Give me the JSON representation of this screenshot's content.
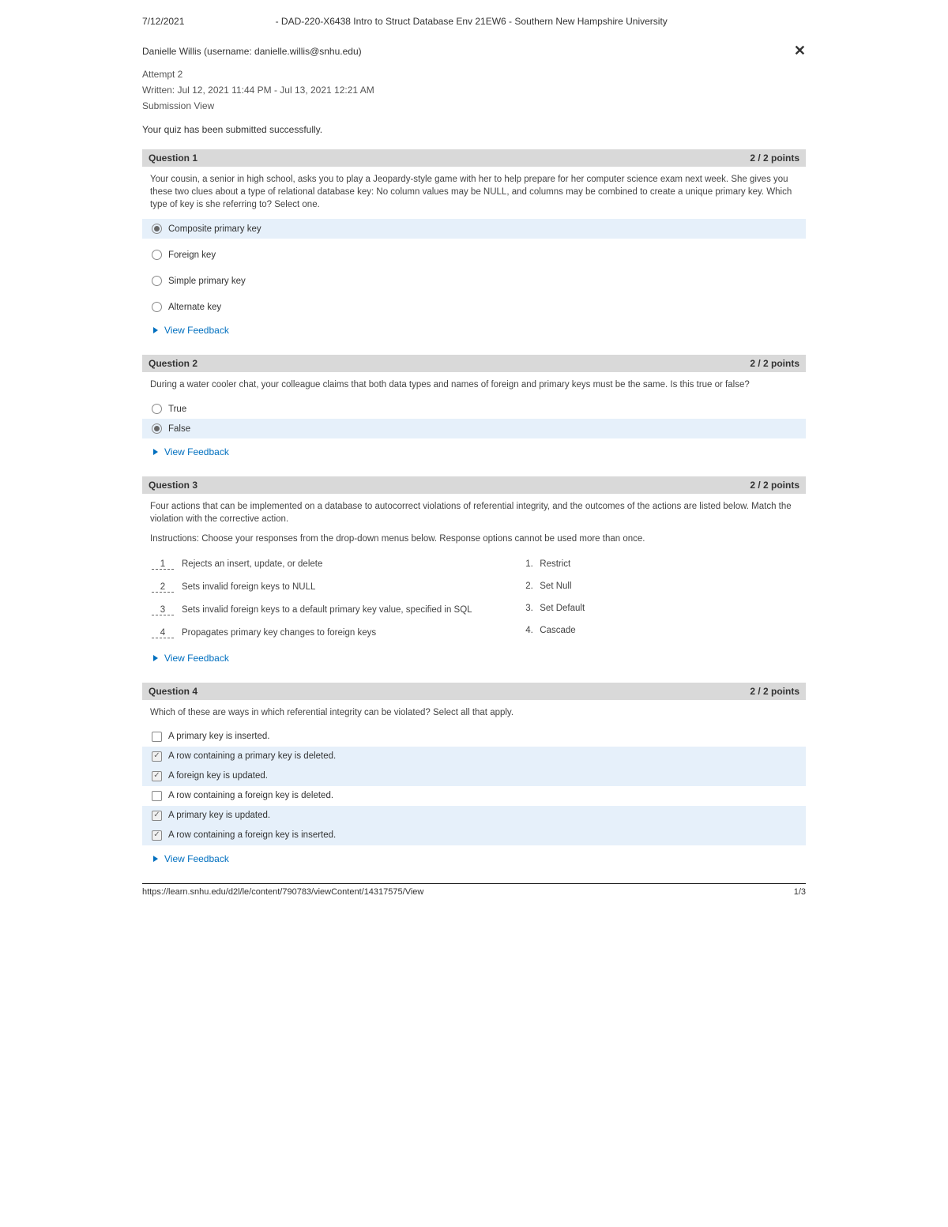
{
  "print": {
    "date": "7/12/2021",
    "title": "- DAD-220-X6438 Intro to Struct Database Env 21EW6 - Southern New Hampshire University",
    "footer_url": "https://learn.snhu.edu/d2l/le/content/790783/viewContent/14317575/View",
    "page_num": "1/3"
  },
  "header": {
    "user_line": "Danielle Willis (username: danielle.willis@snhu.edu)",
    "attempt": "Attempt 2",
    "written": "Written: Jul 12, 2021 11:44 PM - Jul 13, 2021 12:21 AM",
    "view": "Submission View",
    "success": "Your quiz has been submitted successfully."
  },
  "feedback_label": "View Feedback",
  "q1": {
    "title": "Question 1",
    "points": "2 / 2 points",
    "prompt": "Your cousin, a senior in high school, asks you to play a Jeopardy-style game with her to help prepare for her computer science exam next week. She gives you these two clues about a type of relational database key: No column values may be NULL, and columns may be combined to create a unique primary key. Which type of key is she referring to? Select one.",
    "options": [
      {
        "label": "Composite primary key",
        "selected": true
      },
      {
        "label": "Foreign key",
        "selected": false
      },
      {
        "label": "Simple primary key",
        "selected": false
      },
      {
        "label": "Alternate key",
        "selected": false
      }
    ]
  },
  "q2": {
    "title": "Question 2",
    "points": "2 / 2 points",
    "prompt": "During a water cooler chat, your colleague claims that both data types and names of foreign and primary keys must be the same. Is this true or false?",
    "options": [
      {
        "label": "True",
        "selected": false
      },
      {
        "label": "False",
        "selected": true
      }
    ]
  },
  "q3": {
    "title": "Question 3",
    "points": "2 / 2 points",
    "prompt": "Four actions that can be implemented on a database to autocorrect violations of referential integrity, and the outcomes of the actions are listed below. Match the violation with the corrective action.",
    "instructions": "Instructions: Choose your responses from the drop-down menus below. Response options cannot be used more than once.",
    "left": [
      {
        "num": "1",
        "text": "Rejects an insert, update, or delete"
      },
      {
        "num": "2",
        "text": "Sets invalid foreign keys to NULL"
      },
      {
        "num": "3",
        "text": "Sets invalid foreign keys to a default primary key value, specified in SQL"
      },
      {
        "num": "4",
        "text": "Propagates primary key changes to foreign keys"
      }
    ],
    "right": [
      {
        "num": "1.",
        "text": "Restrict"
      },
      {
        "num": "2.",
        "text": "Set Null"
      },
      {
        "num": "3.",
        "text": "Set Default"
      },
      {
        "num": "4.",
        "text": "Cascade"
      }
    ]
  },
  "q4": {
    "title": "Question 4",
    "points": "2 / 2 points",
    "prompt": "Which of these are ways in which referential integrity can be violated? Select all that apply.",
    "options": [
      {
        "label": "A primary key is inserted.",
        "checked": false
      },
      {
        "label": "A row containing a primary key is deleted.",
        "checked": true
      },
      {
        "label": "A foreign key is updated.",
        "checked": true
      },
      {
        "label": "A row containing a foreign key is deleted.",
        "checked": false
      },
      {
        "label": "A primary key is updated.",
        "checked": true
      },
      {
        "label": "A row containing a foreign key is inserted.",
        "checked": true
      }
    ]
  }
}
